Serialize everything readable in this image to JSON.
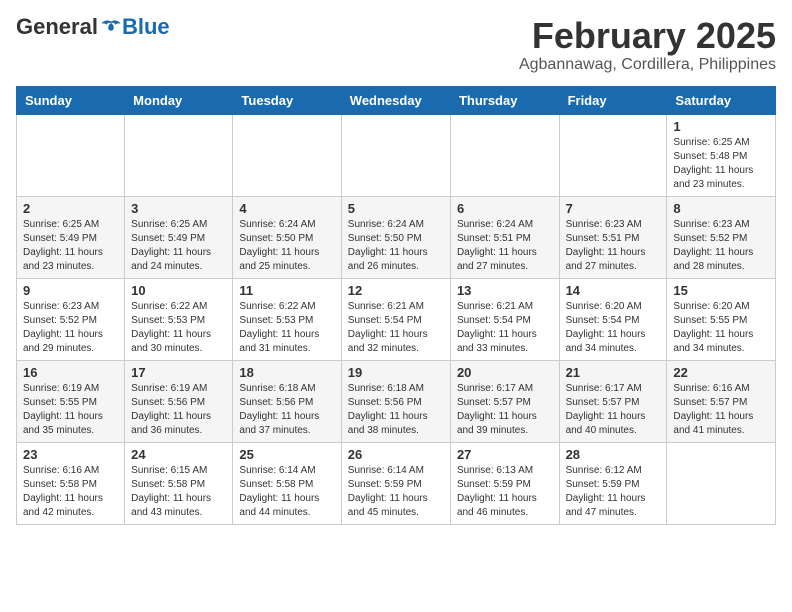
{
  "header": {
    "logo": {
      "general": "General",
      "blue": "Blue"
    },
    "title": "February 2025",
    "location": "Agbannawag, Cordillera, Philippines"
  },
  "weekdays": [
    "Sunday",
    "Monday",
    "Tuesday",
    "Wednesday",
    "Thursday",
    "Friday",
    "Saturday"
  ],
  "weeks": [
    [
      {
        "day": "",
        "info": ""
      },
      {
        "day": "",
        "info": ""
      },
      {
        "day": "",
        "info": ""
      },
      {
        "day": "",
        "info": ""
      },
      {
        "day": "",
        "info": ""
      },
      {
        "day": "",
        "info": ""
      },
      {
        "day": "1",
        "info": "Sunrise: 6:25 AM\nSunset: 5:48 PM\nDaylight: 11 hours\nand 23 minutes."
      }
    ],
    [
      {
        "day": "2",
        "info": "Sunrise: 6:25 AM\nSunset: 5:49 PM\nDaylight: 11 hours\nand 23 minutes."
      },
      {
        "day": "3",
        "info": "Sunrise: 6:25 AM\nSunset: 5:49 PM\nDaylight: 11 hours\nand 24 minutes."
      },
      {
        "day": "4",
        "info": "Sunrise: 6:24 AM\nSunset: 5:50 PM\nDaylight: 11 hours\nand 25 minutes."
      },
      {
        "day": "5",
        "info": "Sunrise: 6:24 AM\nSunset: 5:50 PM\nDaylight: 11 hours\nand 26 minutes."
      },
      {
        "day": "6",
        "info": "Sunrise: 6:24 AM\nSunset: 5:51 PM\nDaylight: 11 hours\nand 27 minutes."
      },
      {
        "day": "7",
        "info": "Sunrise: 6:23 AM\nSunset: 5:51 PM\nDaylight: 11 hours\nand 27 minutes."
      },
      {
        "day": "8",
        "info": "Sunrise: 6:23 AM\nSunset: 5:52 PM\nDaylight: 11 hours\nand 28 minutes."
      }
    ],
    [
      {
        "day": "9",
        "info": "Sunrise: 6:23 AM\nSunset: 5:52 PM\nDaylight: 11 hours\nand 29 minutes."
      },
      {
        "day": "10",
        "info": "Sunrise: 6:22 AM\nSunset: 5:53 PM\nDaylight: 11 hours\nand 30 minutes."
      },
      {
        "day": "11",
        "info": "Sunrise: 6:22 AM\nSunset: 5:53 PM\nDaylight: 11 hours\nand 31 minutes."
      },
      {
        "day": "12",
        "info": "Sunrise: 6:21 AM\nSunset: 5:54 PM\nDaylight: 11 hours\nand 32 minutes."
      },
      {
        "day": "13",
        "info": "Sunrise: 6:21 AM\nSunset: 5:54 PM\nDaylight: 11 hours\nand 33 minutes."
      },
      {
        "day": "14",
        "info": "Sunrise: 6:20 AM\nSunset: 5:54 PM\nDaylight: 11 hours\nand 34 minutes."
      },
      {
        "day": "15",
        "info": "Sunrise: 6:20 AM\nSunset: 5:55 PM\nDaylight: 11 hours\nand 34 minutes."
      }
    ],
    [
      {
        "day": "16",
        "info": "Sunrise: 6:19 AM\nSunset: 5:55 PM\nDaylight: 11 hours\nand 35 minutes."
      },
      {
        "day": "17",
        "info": "Sunrise: 6:19 AM\nSunset: 5:56 PM\nDaylight: 11 hours\nand 36 minutes."
      },
      {
        "day": "18",
        "info": "Sunrise: 6:18 AM\nSunset: 5:56 PM\nDaylight: 11 hours\nand 37 minutes."
      },
      {
        "day": "19",
        "info": "Sunrise: 6:18 AM\nSunset: 5:56 PM\nDaylight: 11 hours\nand 38 minutes."
      },
      {
        "day": "20",
        "info": "Sunrise: 6:17 AM\nSunset: 5:57 PM\nDaylight: 11 hours\nand 39 minutes."
      },
      {
        "day": "21",
        "info": "Sunrise: 6:17 AM\nSunset: 5:57 PM\nDaylight: 11 hours\nand 40 minutes."
      },
      {
        "day": "22",
        "info": "Sunrise: 6:16 AM\nSunset: 5:57 PM\nDaylight: 11 hours\nand 41 minutes."
      }
    ],
    [
      {
        "day": "23",
        "info": "Sunrise: 6:16 AM\nSunset: 5:58 PM\nDaylight: 11 hours\nand 42 minutes."
      },
      {
        "day": "24",
        "info": "Sunrise: 6:15 AM\nSunset: 5:58 PM\nDaylight: 11 hours\nand 43 minutes."
      },
      {
        "day": "25",
        "info": "Sunrise: 6:14 AM\nSunset: 5:58 PM\nDaylight: 11 hours\nand 44 minutes."
      },
      {
        "day": "26",
        "info": "Sunrise: 6:14 AM\nSunset: 5:59 PM\nDaylight: 11 hours\nand 45 minutes."
      },
      {
        "day": "27",
        "info": "Sunrise: 6:13 AM\nSunset: 5:59 PM\nDaylight: 11 hours\nand 46 minutes."
      },
      {
        "day": "28",
        "info": "Sunrise: 6:12 AM\nSunset: 5:59 PM\nDaylight: 11 hours\nand 47 minutes."
      },
      {
        "day": "",
        "info": ""
      }
    ]
  ]
}
